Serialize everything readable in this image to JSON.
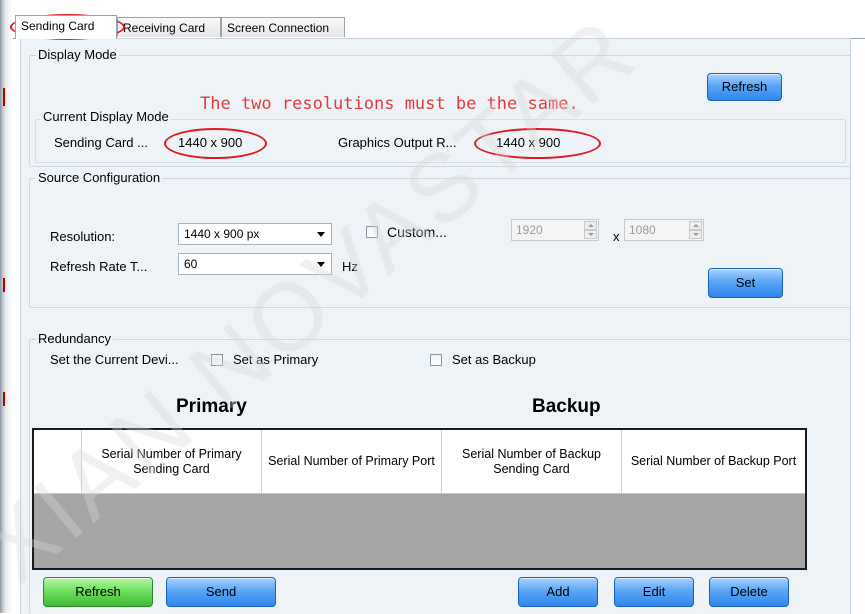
{
  "tabs": [
    {
      "label": "Sending Card",
      "active": true
    },
    {
      "label": "Receiving Card",
      "active": false
    },
    {
      "label": "Screen Connection",
      "active": false
    }
  ],
  "display_mode": {
    "title": "Display Mode",
    "refresh_label": "Refresh",
    "current_title": "Current Display Mode",
    "sending_card_label": "Sending Card ...",
    "sending_card_value": "1440 x 900",
    "graphics_output_label": "Graphics Output R...",
    "graphics_output_value": "1440 x 900"
  },
  "annotation": {
    "text": "The two resolutions must be the same.",
    "color": "#e03c3c"
  },
  "source_config": {
    "title": "Source Configuration",
    "resolution_label": "Resolution:",
    "resolution_value": "1440 x 900 px",
    "custom_label": "Custom...",
    "custom_checked": false,
    "custom_width": "1920",
    "x_label": "x",
    "custom_height": "1080",
    "refresh_rate_label": "Refresh Rate T...",
    "refresh_rate_value": "60",
    "hz_label": "Hz",
    "set_label": "Set"
  },
  "redundancy": {
    "title": "Redundancy",
    "set_current_label": "Set the Current Devi...",
    "set_primary_label": "Set as Primary",
    "set_primary_checked": false,
    "set_backup_label": "Set as Backup",
    "set_backup_checked": false,
    "primary_title": "Primary",
    "backup_title": "Backup",
    "columns": [
      "Serial Number of Primary Sending Card",
      "Serial Number of Primary Port",
      "Serial Number of Backup Sending Card",
      "Serial Number of Backup Port"
    ],
    "rows": []
  },
  "bottom_buttons": {
    "refresh": "Refresh",
    "send": "Send",
    "add": "Add",
    "edit": "Edit",
    "delete": "Delete"
  },
  "watermark": "XIAN NOVASTAR",
  "colors": {
    "button_blue": "#4a9af5",
    "button_green": "#5fd655",
    "annotation_red": "#e0191e",
    "panel_bg": "#eef3f8"
  }
}
